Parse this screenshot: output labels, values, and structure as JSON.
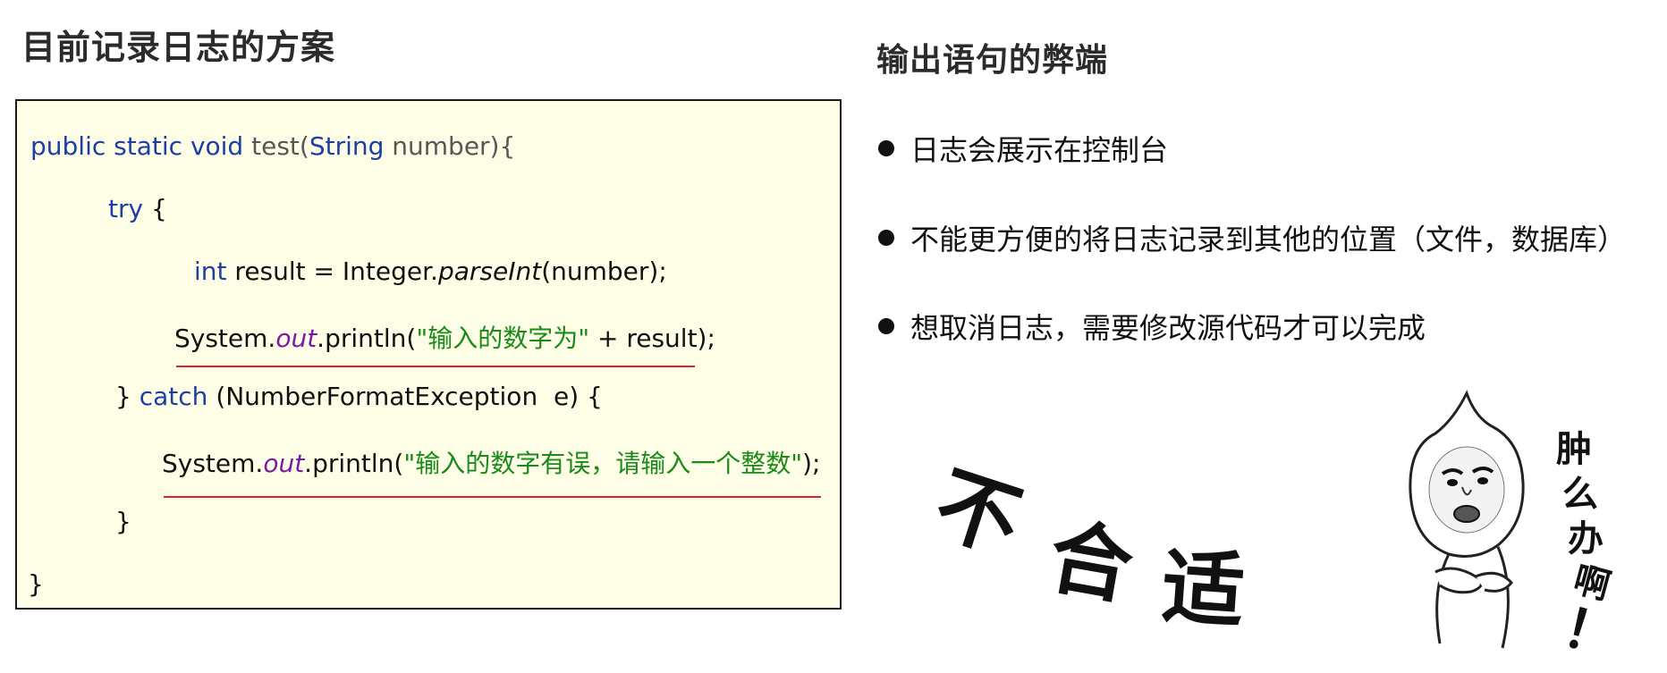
{
  "left_title": "目前记录日志的方案",
  "right_title": "输出语句的弊端",
  "code": {
    "line1": {
      "kw1": "public static",
      "kw2": "void",
      "name": "test(",
      "type": "String",
      "rest": "number){"
    },
    "line2": {
      "kw": "try",
      "rest": "{"
    },
    "line3": {
      "kw": "int",
      "pre": "result = Integer.",
      "method": "parseInt",
      "post": "(number);"
    },
    "line4": {
      "pre": "System.",
      "field": "out",
      "mid": ".println(",
      "str": "\"输入的数字为\"",
      "post": " + result);"
    },
    "line5": {
      "brace": "}",
      "kw": "catch",
      "rest": "(NumberFormatException  e) {"
    },
    "line6": {
      "pre": "System.",
      "field": "out",
      "mid": ".println(",
      "str": "\"输入的数字有误，请输入一个整数\"",
      "post": ");"
    },
    "line7": {
      "text": "}"
    },
    "line8": {
      "text": "}"
    }
  },
  "bullets": [
    "日志会展示在控制台",
    "不能更方便的将日志记录到其他的位置（文件，数据库）",
    "想取消日志，需要修改源代码才可以完成"
  ],
  "meme": {
    "buhe": [
      "不",
      "合",
      "适"
    ],
    "side_text": [
      "肿",
      "么",
      "办",
      "啊",
      "！"
    ]
  },
  "colors": {
    "code_bg": "#fefee6",
    "keyword": "#1c3ea6",
    "string": "#1a8a1a",
    "field": "#7a1aa6",
    "underline": "#d9252b"
  }
}
